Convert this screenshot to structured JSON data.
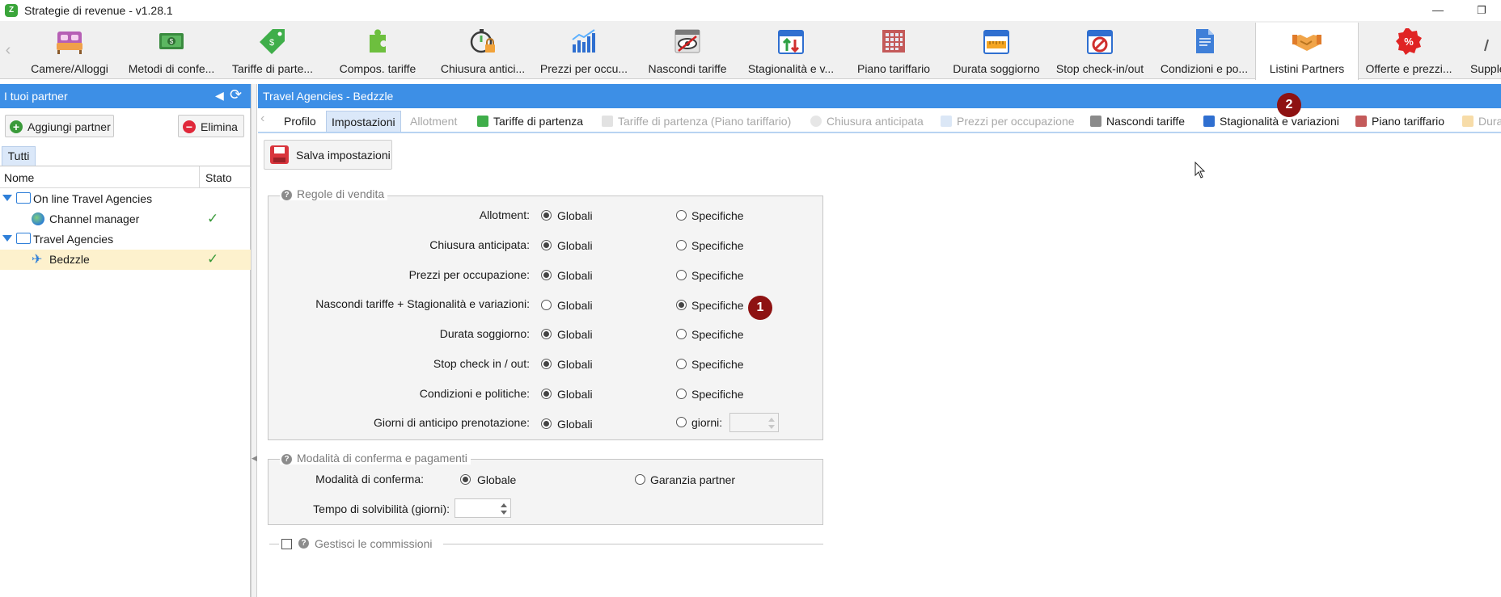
{
  "window": {
    "title": "Strategie di revenue - v1.28.1",
    "logo_text": "Z",
    "minimize": "—",
    "restore": "❐"
  },
  "toolbar": {
    "items": [
      {
        "label": "Camere/Alloggi",
        "icon": "bed-icon"
      },
      {
        "label": "Metodi di confe...",
        "icon": "money-icon"
      },
      {
        "label": "Tariffe di parte...",
        "icon": "price-tag-icon"
      },
      {
        "label": "Compos. tariffe",
        "icon": "puzzle-icon"
      },
      {
        "label": "Chiusura antici...",
        "icon": "timer-lock-icon"
      },
      {
        "label": "Prezzi per occu...",
        "icon": "bar-chart-icon"
      },
      {
        "label": "Nascondi tariffe",
        "icon": "hidden-eye-icon"
      },
      {
        "label": "Stagionalità e v...",
        "icon": "calendar-arrows-icon"
      },
      {
        "label": "Piano tariffario",
        "icon": "grid-icon"
      },
      {
        "label": "Durata soggiorno",
        "icon": "calendar-ruler-icon"
      },
      {
        "label": "Stop check-in/out",
        "icon": "calendar-stop-icon"
      },
      {
        "label": "Condizioni e po...",
        "icon": "document-icon"
      },
      {
        "label": "Listini Partners",
        "icon": "handshake-icon"
      },
      {
        "label": "Offerte e prezzi...",
        "icon": "percent-badge-icon"
      },
      {
        "label": "Supple",
        "icon": "partial-icon"
      }
    ],
    "active_index": 12
  },
  "left_panel": {
    "title": "I tuoi partner",
    "add_button": "Aggiungi partner",
    "delete_button": "Elimina",
    "tab": "Tutti",
    "columns": {
      "name": "Nome",
      "state": "Stato"
    },
    "tree": [
      {
        "label": "On line Travel Agencies",
        "type": "group"
      },
      {
        "label": "Channel manager",
        "type": "item",
        "active": true
      },
      {
        "label": "Travel Agencies",
        "type": "group"
      },
      {
        "label": "Bedzzle",
        "type": "item",
        "active": true,
        "selected": true
      }
    ],
    "check": "✓"
  },
  "right_panel": {
    "title": "Travel Agencies - Bedzzle",
    "subtabs": [
      {
        "label": "Profilo",
        "state": "normal"
      },
      {
        "label": "Impostazioni",
        "state": "active"
      },
      {
        "label": "Allotment",
        "state": "disabled"
      },
      {
        "label": "Tariffe di partenza",
        "state": "normal"
      },
      {
        "label": "Tariffe di partenza (Piano tariffario)",
        "state": "disabled"
      },
      {
        "label": "Chiusura anticipata",
        "state": "disabled"
      },
      {
        "label": "Prezzi per occupazione",
        "state": "disabled"
      },
      {
        "label": "Nascondi tariffe",
        "state": "normal"
      },
      {
        "label": "Stagionalità e variazioni",
        "state": "normal"
      },
      {
        "label": "Piano tariffario",
        "state": "normal"
      },
      {
        "label": "Dura",
        "state": "disabled"
      }
    ],
    "save_button": "Salva impostazioni",
    "sales_rules": {
      "legend": "Regole di vendita",
      "option_global": "Globali",
      "option_specific": "Specifiche",
      "rows": [
        {
          "label": "Allotment:",
          "selected": "global"
        },
        {
          "label": "Chiusura anticipata:",
          "selected": "global"
        },
        {
          "label": "Prezzi per occupazione:",
          "selected": "global"
        },
        {
          "label": "Nascondi tariffe + Stagionalità e variazioni:",
          "selected": "specific"
        },
        {
          "label": "Durata soggiorno:",
          "selected": "global"
        },
        {
          "label": "Stop check in / out:",
          "selected": "global"
        },
        {
          "label": "Condizioni e politiche:",
          "selected": "global"
        }
      ],
      "advance_booking": {
        "label": "Giorni di anticipo prenotazione:",
        "option_global": "Globali",
        "option_days": "giorni:",
        "selected": "global",
        "days_value": ""
      }
    },
    "confirmation": {
      "legend": "Modalità di conferma e pagamenti",
      "mode_label": "Modalità di conferma:",
      "option_global": "Globale",
      "option_partner": "Garanzia partner",
      "selected": "global",
      "solvency_label": "Tempo di solvibilità (giorni):",
      "solvency_value": ""
    },
    "commissions": {
      "label": "Gestisci le commissioni",
      "checked": false
    }
  },
  "annotations": {
    "badge_1": "1",
    "badge_2": "2"
  },
  "help_glyph": "?"
}
